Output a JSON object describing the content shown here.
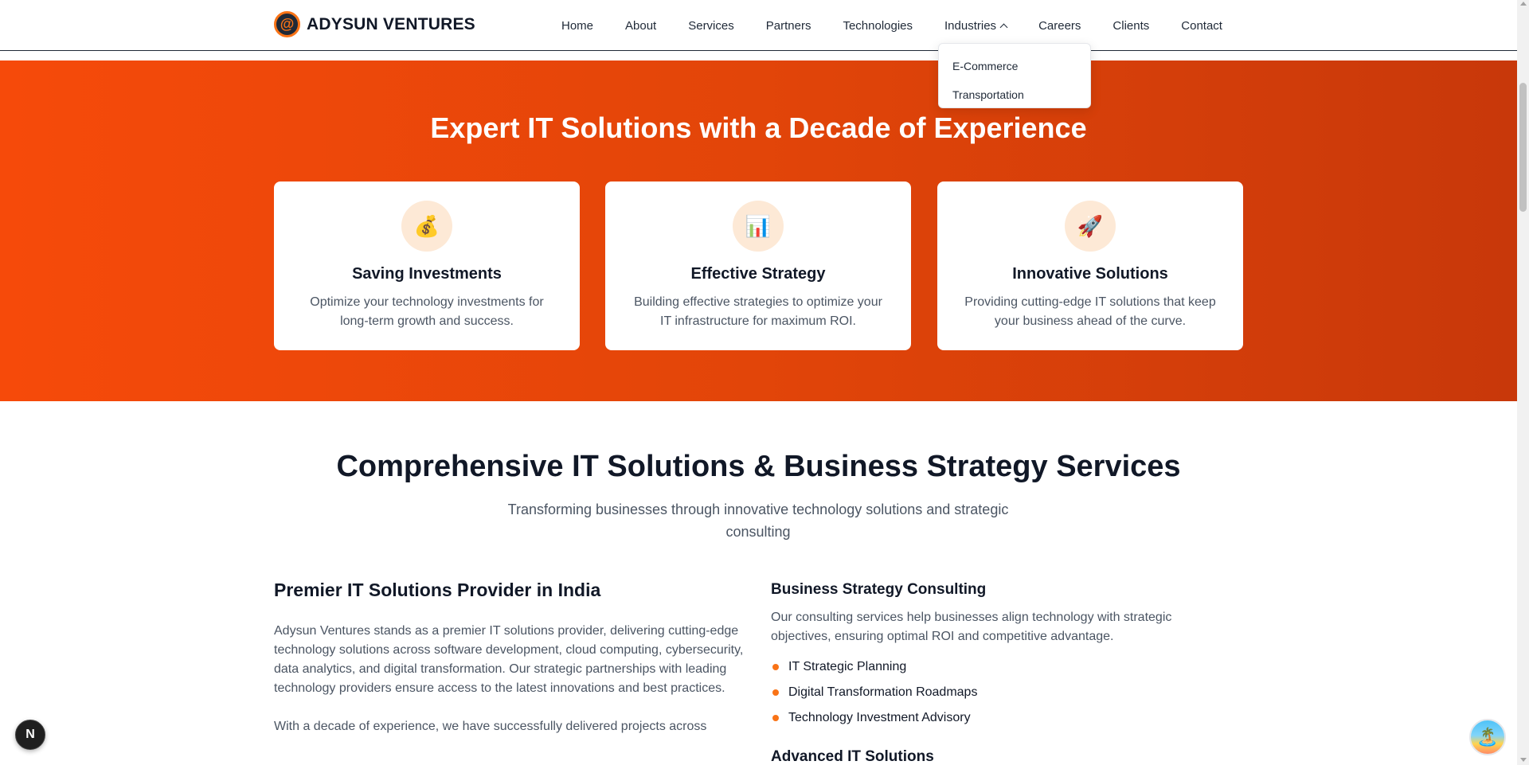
{
  "header": {
    "brand_logo_glyph": "@",
    "brand_name": "ADYSUN VENTURES",
    "nav": [
      "Home",
      "About",
      "Services",
      "Partners",
      "Technologies",
      "Industries",
      "Careers",
      "Clients",
      "Contact"
    ],
    "dropdown": [
      "E-Commerce",
      "Transportation"
    ]
  },
  "hero": {
    "title": "Expert IT Solutions with a Decade of Experience",
    "cards": [
      {
        "icon": "💰",
        "icon_name": "money-bag-icon",
        "title": "Saving Investments",
        "desc": "Optimize your technology investments for long-term growth and success."
      },
      {
        "icon": "📊",
        "icon_name": "bar-chart-icon",
        "title": "Effective Strategy",
        "desc": "Building effective strategies to optimize your IT infrastructure for maximum ROI."
      },
      {
        "icon": "🚀",
        "icon_name": "rocket-icon",
        "title": "Innovative Solutions",
        "desc": "Providing cutting-edge IT solutions that keep your business ahead of the curve."
      }
    ]
  },
  "section": {
    "title": "Comprehensive IT Solutions & Business Strategy Services",
    "subtitle": "Transforming businesses through innovative technology solutions and strategic consulting",
    "left": {
      "title": "Premier IT Solutions Provider in India",
      "para1": "Adysun Ventures stands as a premier IT solutions provider, delivering cutting-edge technology solutions across software development, cloud computing, cybersecurity, data analytics, and digital transformation. Our strategic partnerships with leading technology providers ensure access to the latest innovations and best practices.",
      "para2": "With a decade of experience, we have successfully delivered projects across"
    },
    "right": {
      "title": "Business Strategy Consulting",
      "desc": "Our consulting services help businesses align technology with strategic objectives, ensuring optimal ROI and competitive advantage.",
      "bullets": [
        "IT Strategic Planning",
        "Digital Transformation Roadmaps",
        "Technology Investment Advisory"
      ],
      "title2": "Advanced IT Solutions"
    }
  },
  "floating": {
    "n_badge": "N",
    "chat_icon": "🏝️"
  },
  "colors": {
    "accent": "#f97316",
    "hero_start": "#f64a0a",
    "hero_end": "#c8380a"
  }
}
